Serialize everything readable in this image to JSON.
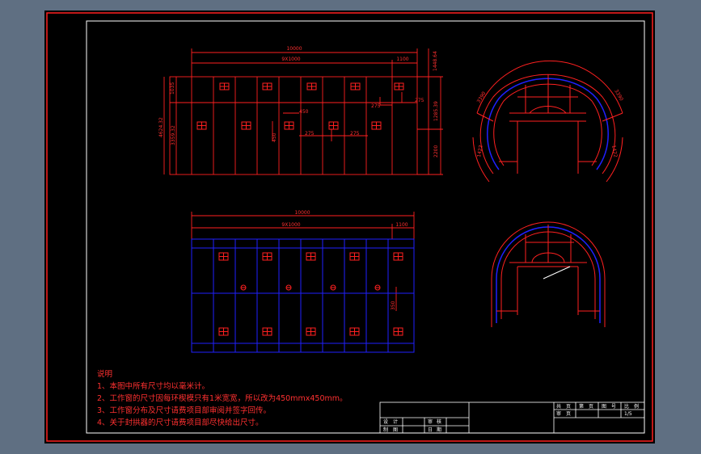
{
  "drawing": {
    "notes": {
      "title": "说明",
      "lines": [
        "1、本图中所有尺寸均以毫米计。",
        "2、工作窗的尺寸因每环楔模只有1米宽宽，所以改为450mmx450mm。",
        "3、工作窗分布及尺寸请费项目部审阅并签字回传。",
        "4、关于封拱器的尺寸请费项目部尽快给出尺寸。"
      ]
    },
    "top_view": {
      "dim_total": "10000",
      "dim_main": "9X1000",
      "dim_end": "1100",
      "dim_right_a": "1448.64",
      "dim_right_b": "1285.39",
      "dim_right_c": "2200",
      "dim_left_a": "1035",
      "dim_left_b": "4624.32",
      "dim_left_c": "3359.32",
      "dim_450a": "450",
      "dim_450b": "450",
      "dim_275a": "275",
      "dim_275b": "275",
      "dim_275c": "275",
      "dim_275d": "275"
    },
    "bottom_view": {
      "dim_total": "10000",
      "dim_main": "9X1000",
      "dim_end": "1100",
      "dim_v": "350"
    },
    "section_a": {
      "dims": [
        "3390",
        "3390",
        "1422",
        "1422"
      ]
    },
    "title_block": {
      "r1": [
        "共",
        "页",
        "第",
        "页",
        "图",
        "号",
        "比",
        "例"
      ],
      "r2": [
        "审",
        "页"
      ],
      "r3": [
        "1/5"
      ],
      "left_r1": [
        "设",
        "计",
        "审",
        "核"
      ],
      "left_r2": [
        "制",
        "图",
        "日",
        "期"
      ]
    }
  }
}
